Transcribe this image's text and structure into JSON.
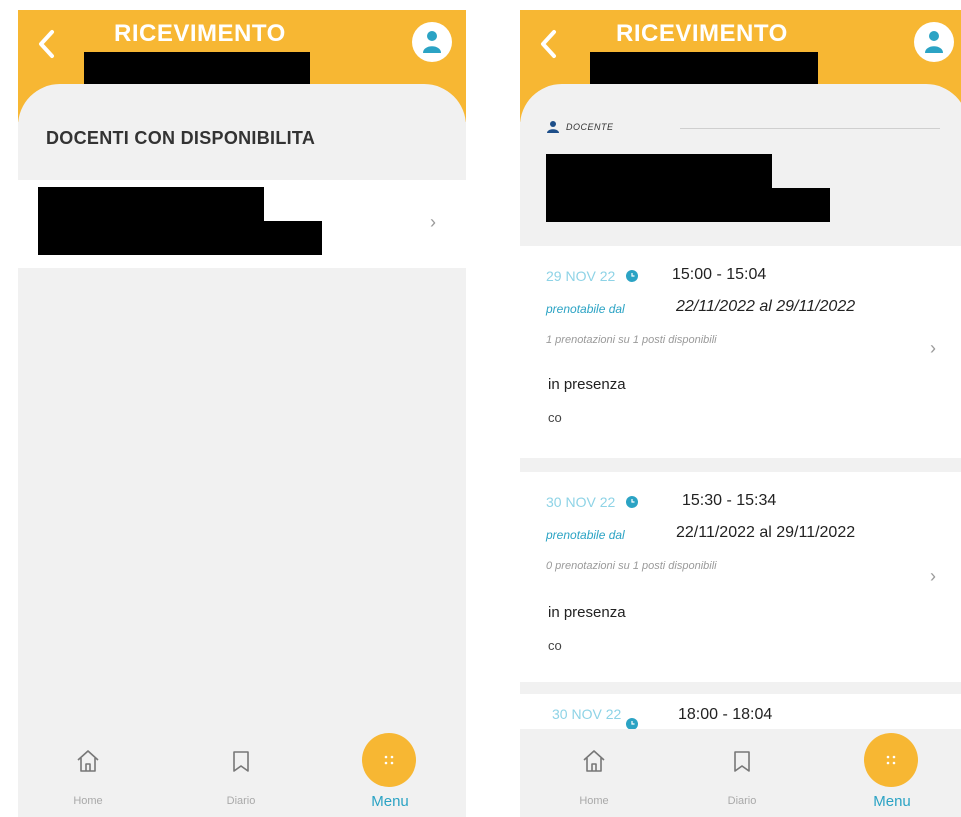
{
  "left": {
    "header": {
      "title": "RICEVIMENTO",
      "back_icon": "chevron-left-icon",
      "avatar_icon": "user-icon"
    },
    "section_title": "DOCENTI CON DISPONIBILITA",
    "teacher_row": {
      "chevron": "›"
    },
    "nav": {
      "home": "Home",
      "diary": "Diario",
      "menu": "Menu"
    }
  },
  "right": {
    "header": {
      "title": "RICEVIMENTO",
      "back_icon": "chevron-left-icon",
      "avatar_icon": "user-icon"
    },
    "teacher_label": "DOCENTE",
    "slots": [
      {
        "date": "29 NOV 22",
        "time": "15:00 - 15:04",
        "bookable_label": "prenotabile dal",
        "bookable_range": "22/11/2022 al 29/11/2022",
        "bookings": "1 prenotazioni su 1 posti disponibili",
        "mode": "in presenza",
        "mode_sub": "co",
        "chevron": "›"
      },
      {
        "date": "30 NOV 22",
        "time": "15:30 - 15:34",
        "bookable_label": "prenotabile dal",
        "bookable_range": "22/11/2022 al 29/11/2022",
        "bookings": "0 prenotazioni su 1 posti disponibili",
        "mode": "in presenza",
        "mode_sub": "co",
        "chevron": "›"
      },
      {
        "date": "30 NOV 22",
        "time": "18:00 - 18:04"
      }
    ],
    "nav": {
      "home": "Home",
      "diary": "Diario",
      "menu": "Menu"
    }
  },
  "colors": {
    "accent": "#f7b733",
    "teal": "#2ba3c4",
    "light_teal": "#8ed3e6",
    "panel": "#f1f1f1"
  }
}
